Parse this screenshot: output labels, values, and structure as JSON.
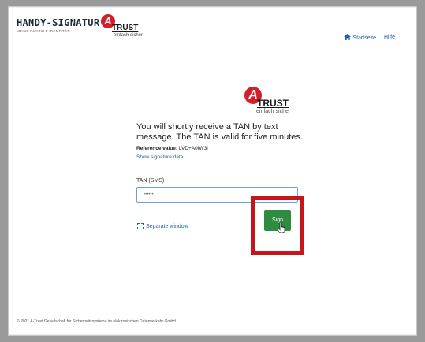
{
  "header": {
    "brand_title": "HANDY-SIGNATUR",
    "brand_subtitle": "MEINE DIGITALE IDENTITÄT",
    "logo": {
      "letter": "A",
      "word": "TRUST",
      "tagline": "einfach sicher"
    },
    "nav": {
      "home_label": "Startseite",
      "help_label": "Hilfe"
    }
  },
  "main": {
    "logo": {
      "letter": "A",
      "word": "TRUST",
      "tagline": "einfach sicher"
    },
    "message": "You will shortly receive a TAN by text message. The TAN is valid for five minutes.",
    "reference_label": "Reference value:",
    "reference_value": "LVD+A0fW3l",
    "show_signature_link": "Show signature data",
    "tan_label": "TAN (SMS)",
    "tan_value": "",
    "tan_placeholder": "••••••",
    "separate_window_link": "Separate window",
    "sign_button": "Sign"
  },
  "footer": {
    "copyright": "© 2021 A-Trust Gesellschaft für Sicherheitssysteme im elektronischen Datenverkehr GmbH"
  },
  "colors": {
    "accent_red": "#c4161c",
    "logo_red": "#d21f2a",
    "link_blue": "#1f5fa8",
    "sign_green": "#2e8b3f"
  }
}
